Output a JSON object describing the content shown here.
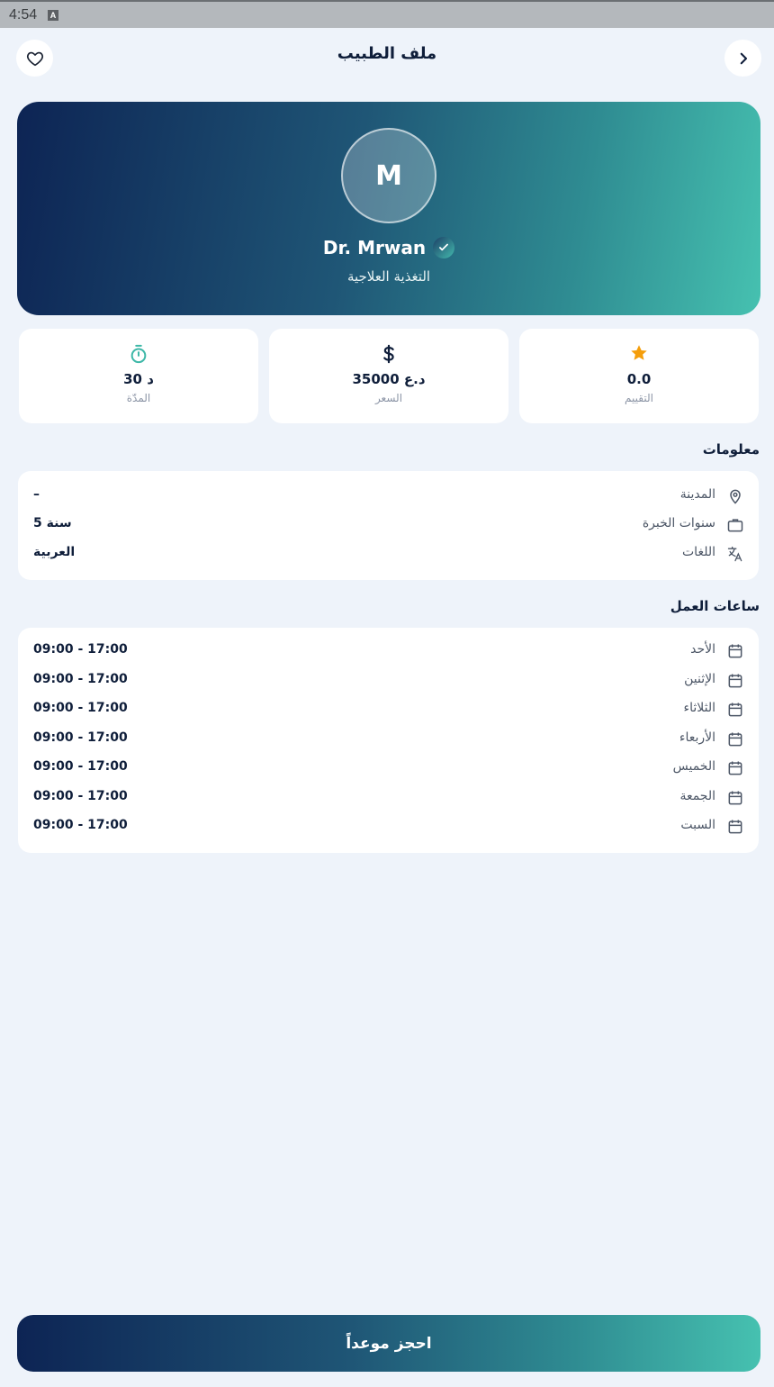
{
  "status_bar": {
    "time": "4:54",
    "icon_letter": "A"
  },
  "header": {
    "title": "ملف الطبيب",
    "back_icon": "chevron-icon",
    "favorite_icon": "heart-icon"
  },
  "profile": {
    "initial": "M",
    "name": "Dr. Mrwan",
    "specialty": "التغذية العلاجية"
  },
  "stats": [
    {
      "icon": "star-icon",
      "value": "0.0",
      "label": "التقييم",
      "color": "#f59e0b"
    },
    {
      "icon": "dollar-icon",
      "value": "35000 د.ع",
      "label": "السعر",
      "color": "#0f1e3a"
    },
    {
      "icon": "timer-icon",
      "value": "30 د",
      "label": "المدّة",
      "color": "#3fb8a8"
    }
  ],
  "info": {
    "title": "معلومات",
    "rows": [
      {
        "icon": "location-icon",
        "label": "المدينة",
        "value": "–"
      },
      {
        "icon": "briefcase-icon",
        "label": "سنوات الخبرة",
        "value": "5 سنة"
      },
      {
        "icon": "translate-icon",
        "label": "اللغات",
        "value": "العربية"
      }
    ]
  },
  "hours": {
    "title": "ساعات العمل",
    "days": [
      {
        "day": "الأحد",
        "time": "09:00 - 17:00"
      },
      {
        "day": "الإثنين",
        "time": "09:00 - 17:00"
      },
      {
        "day": "الثلاثاء",
        "time": "09:00 - 17:00"
      },
      {
        "day": "الأربعاء",
        "time": "09:00 - 17:00"
      },
      {
        "day": "الخميس",
        "time": "09:00 - 17:00"
      },
      {
        "day": "الجمعة",
        "time": "09:00 - 17:00"
      },
      {
        "day": "السبت",
        "time": "09:00 - 17:00"
      }
    ]
  },
  "book_button": {
    "label": "احجز موعداً"
  },
  "colors": {
    "primary_dark": "#0d2454",
    "accent_teal": "#46c1b0",
    "background": "#eef3fa"
  }
}
